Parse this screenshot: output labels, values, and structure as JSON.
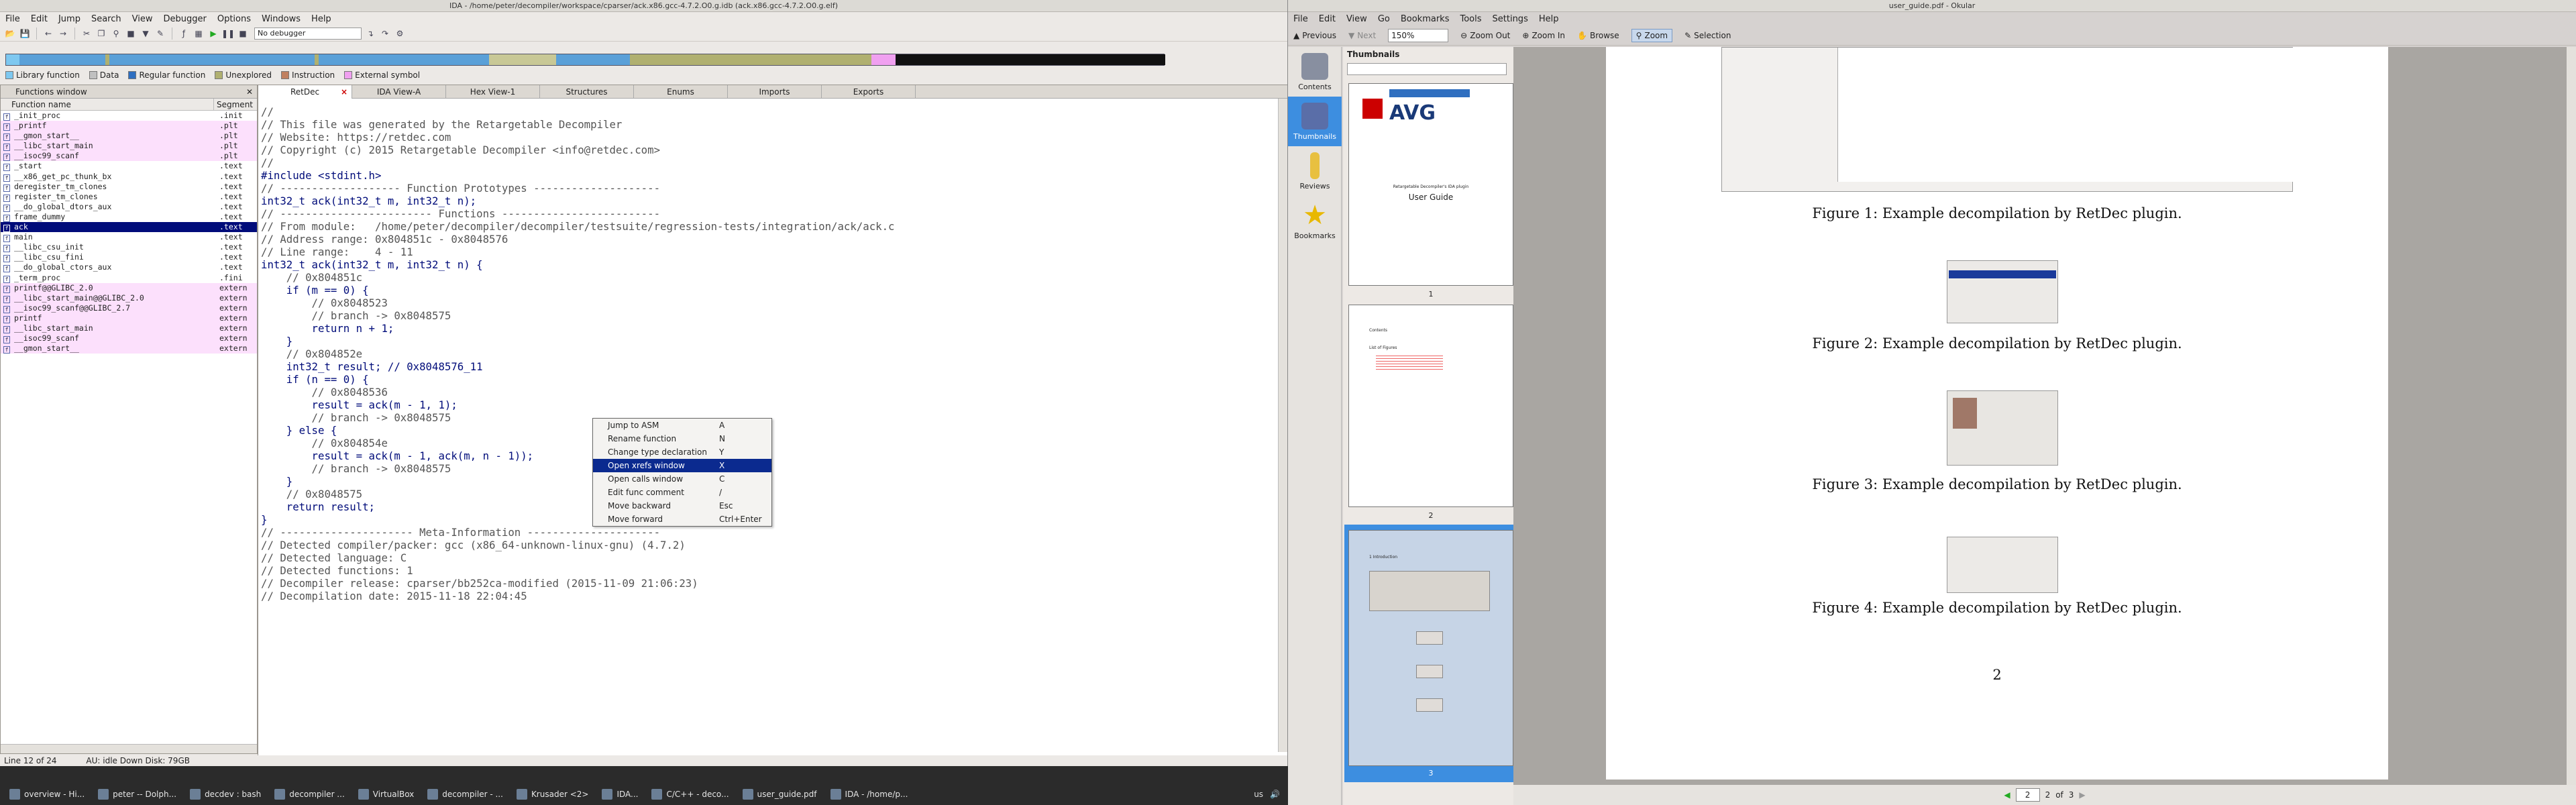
{
  "ida": {
    "title": "IDA - /home/peter/decompiler/workspace/cparser/ack.x86.gcc-4.7.2.O0.g.idb (ack.x86.gcc-4.7.2.O0.g.elf)",
    "menu": [
      "File",
      "Edit",
      "Jump",
      "Search",
      "View",
      "Debugger",
      "Options",
      "Windows",
      "Help"
    ],
    "debugger": "No debugger",
    "legend": [
      {
        "label": "Library function",
        "color": "#7ec8f0"
      },
      {
        "label": "Data",
        "color": "#c0c0c0"
      },
      {
        "label": "Regular function",
        "color": "#2f6fc0"
      },
      {
        "label": "Unexplored",
        "color": "#b0b070"
      },
      {
        "label": "Instruction",
        "color": "#c08060"
      },
      {
        "label": "External symbol",
        "color": "#f0a0f0"
      }
    ],
    "functions_window": {
      "title": "Functions window",
      "col_name": "Function name",
      "col_segment": "Segment",
      "rows": [
        {
          "name": "_init_proc",
          "seg": ".init",
          "style": ""
        },
        {
          "name": "_printf",
          "seg": ".plt",
          "style": "pink"
        },
        {
          "name": "__gmon_start__",
          "seg": ".plt",
          "style": "pink"
        },
        {
          "name": "__libc_start_main",
          "seg": ".plt",
          "style": "pink"
        },
        {
          "name": "__isoc99_scanf",
          "seg": ".plt",
          "style": "pink"
        },
        {
          "name": "_start",
          "seg": ".text",
          "style": ""
        },
        {
          "name": "__x86_get_pc_thunk_bx",
          "seg": ".text",
          "style": ""
        },
        {
          "name": "deregister_tm_clones",
          "seg": ".text",
          "style": ""
        },
        {
          "name": "register_tm_clones",
          "seg": ".text",
          "style": ""
        },
        {
          "name": "__do_global_dtors_aux",
          "seg": ".text",
          "style": ""
        },
        {
          "name": "frame_dummy",
          "seg": ".text",
          "style": ""
        },
        {
          "name": "ack",
          "seg": ".text",
          "style": "sel"
        },
        {
          "name": "main",
          "seg": ".text",
          "style": ""
        },
        {
          "name": "__libc_csu_init",
          "seg": ".text",
          "style": ""
        },
        {
          "name": "__libc_csu_fini",
          "seg": ".text",
          "style": ""
        },
        {
          "name": "__do_global_ctors_aux",
          "seg": ".text",
          "style": ""
        },
        {
          "name": "_term_proc",
          "seg": ".fini",
          "style": ""
        },
        {
          "name": "printf@@GLIBC_2.0",
          "seg": "extern",
          "style": "pink"
        },
        {
          "name": "__libc_start_main@@GLIBC_2.0",
          "seg": "extern",
          "style": "pink"
        },
        {
          "name": "__isoc99_scanf@@GLIBC_2.7",
          "seg": "extern",
          "style": "pink"
        },
        {
          "name": "printf",
          "seg": "extern",
          "style": "pink"
        },
        {
          "name": "__libc_start_main",
          "seg": "extern",
          "style": "pink"
        },
        {
          "name": "__isoc99_scanf",
          "seg": "extern",
          "style": "pink"
        },
        {
          "name": "__gmon_start__",
          "seg": "extern",
          "style": "pink"
        }
      ]
    },
    "tabs": [
      "RetDec",
      "IDA View-A",
      "Hex View-1",
      "Structures",
      "Enums",
      "Imports",
      "Exports"
    ],
    "code_lines": [
      "//",
      "// This file was generated by the Retargetable Decompiler",
      "// Website: https://retdec.com",
      "// Copyright (c) 2015 Retargetable Decompiler <info@retdec.com>",
      "//",
      "",
      "#include <stdint.h>",
      "",
      "// ------------------- Function Prototypes --------------------",
      "",
      "int32_t ack(int32_t m, int32_t n);",
      "",
      "// ------------------------ Functions -------------------------",
      "",
      "// From module:   /home/peter/decompiler/decompiler/testsuite/regression-tests/integration/ack/ack.c",
      "// Address range: 0x804851c - 0x8048576",
      "// Line range:    4 - 11",
      "int32_t ack(int32_t m, int32_t n) {",
      "    // 0x804851c",
      "    if (m == 0) {",
      "        // 0x8048523",
      "        // branch -> 0x8048575",
      "        return n + 1;",
      "    }",
      "    // 0x804852e",
      "    int32_t result; // 0x8048576_11",
      "    if (n == 0) {",
      "        // 0x8048536",
      "        result = ack(m - 1, 1);",
      "        // branch -> 0x8048575",
      "    } else {",
      "        // 0x804854e",
      "        result = ack(m - 1, ack(m, n - 1));",
      "        // branch -> 0x8048575",
      "    }",
      "    // 0x8048575",
      "    return result;",
      "}",
      "",
      "// --------------------- Meta-Information ---------------------",
      "",
      "// Detected compiler/packer: gcc (x86_64-unknown-linux-gnu) (4.7.2)",
      "// Detected language: C",
      "// Detected functions: 1",
      "// Decompiler release: cparser/bb252ca-modified (2015-11-09 21:06:23)",
      "// Decompilation date: 2015-11-18 22:04:45"
    ],
    "context_menu": [
      {
        "label": "Jump to ASM",
        "shortcut": "A"
      },
      {
        "label": "Rename function",
        "shortcut": "N"
      },
      {
        "label": "Change type declaration",
        "shortcut": "Y"
      },
      {
        "label": "Open xrefs window",
        "shortcut": "X",
        "active": true
      },
      {
        "label": "Open calls window",
        "shortcut": "C"
      },
      {
        "label": "Edit func comment",
        "shortcut": "/"
      },
      {
        "label": "Move backward",
        "shortcut": "Esc"
      },
      {
        "label": "Move forward",
        "shortcut": "Ctrl+Enter"
      }
    ],
    "status_line": "Line 12 of 24",
    "status_bottom": "AU:  idle    Down     Disk: 79GB"
  },
  "okular": {
    "title": "user_guide.pdf - Okular",
    "menu": [
      "File",
      "Edit",
      "View",
      "Go",
      "Bookmarks",
      "Tools",
      "Settings",
      "Help"
    ],
    "toolbar": [
      "Previous",
      "Next",
      "Zoom Out",
      "Zoom In",
      "Browse",
      "Zoom",
      "Selection"
    ],
    "zoom": "150%",
    "sidebar": [
      "Contents",
      "Thumbnails",
      "Reviews",
      "Bookmarks"
    ],
    "thumb_header": "Thumbnails",
    "thumb_page1": {
      "brand": "AVG",
      "subtitle": "Retargetable Decompiler's IDA plugin",
      "heading": "User Guide"
    },
    "thumb_page2": {
      "heading": "Contents",
      "sub": "List of Figures"
    },
    "thumb_page3": {
      "heading": "1 Introduction"
    },
    "thumb_numbers": [
      "1",
      "2",
      "3"
    ],
    "captions": [
      "Figure 1: Example decompilation by RetDec plugin.",
      "Figure 2: Example decompilation by RetDec plugin.",
      "Figure 3: Example decompilation by RetDec plugin.",
      "Figure 4: Example decompilation by RetDec plugin."
    ],
    "page_number": "2",
    "nav": {
      "current": "2",
      "of_label": "of",
      "total": "3"
    }
  },
  "taskbar": {
    "tasks": [
      "overview - Hi...",
      "peter -- Dolph...",
      "decdev : bash",
      "decompiler ...",
      "VirtualBox",
      "decompiler - ...",
      "Krusader <2>",
      "IDA...",
      "C/C++ - deco...",
      "user_guide.pdf",
      "IDA - /home/p..."
    ],
    "layout": "us"
  }
}
